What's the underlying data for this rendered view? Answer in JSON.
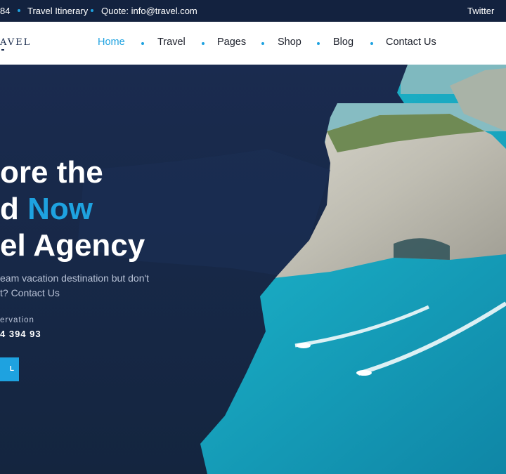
{
  "topbar": {
    "phone_fragment": "84",
    "itinerary": "Travel Itinerary",
    "quote": "Quote: info@travel.com",
    "social": "Twitter"
  },
  "brand": {
    "logo_text": "AVEL"
  },
  "nav": {
    "items": [
      {
        "label": "Home",
        "active": true
      },
      {
        "label": "Travel",
        "active": false
      },
      {
        "label": "Pages",
        "active": false
      },
      {
        "label": "Shop",
        "active": false
      },
      {
        "label": "Blog",
        "active": false
      },
      {
        "label": "Contact Us",
        "active": false
      }
    ]
  },
  "hero": {
    "line1": "ore the",
    "line2_start": "d ",
    "line2_accent": "Now",
    "line3": "el Agency",
    "desc_line1": "eam vacation destination but don't",
    "desc_line2": "t? Contact Us",
    "reservation_label": "ervation",
    "reservation_phone": "4 394 93",
    "cta_label": "L"
  },
  "colors": {
    "navy": "#16284a",
    "accent": "#1ea2e0",
    "sea": "#1fb3c4"
  }
}
